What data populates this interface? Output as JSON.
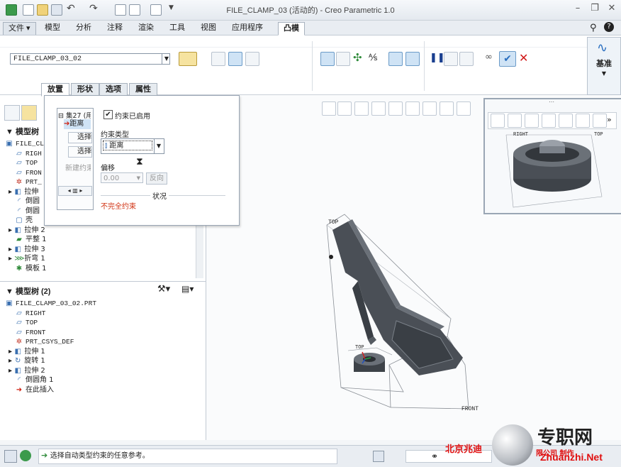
{
  "window": {
    "title": "FILE_CLAMP_03 (活动的) - Creo Parametric 1.0"
  },
  "menu": {
    "file": "文件",
    "tabs": [
      "模型",
      "分析",
      "注释",
      "渲染",
      "工具",
      "视图",
      "应用程序",
      "凸模"
    ],
    "active_tab": "凸模"
  },
  "ribbon": {
    "reference_model": "FILE_CLAMP_03_02",
    "datum_label": "基准"
  },
  "dashboard_tabs": [
    "放置",
    "形状",
    "选项",
    "属性"
  ],
  "placement": {
    "set_label": "集27 (用",
    "constraint_item": "距离",
    "select_a": "选择",
    "select_b": "选择",
    "new_constraint": "新建约束",
    "enabled_label": "约束已启用",
    "type_label": "约束类型",
    "type_value": "距离",
    "offset_label": "偏移",
    "offset_value": "0.00",
    "flip_button": "反向",
    "status_label": "状况",
    "status_value": "不完全约束"
  },
  "model_tree_1": {
    "title": "模型树",
    "items": [
      {
        "icon": "part",
        "label": "FILE_CL",
        "mono": true
      },
      {
        "icon": "plane",
        "label": "RIGH",
        "mono": true
      },
      {
        "icon": "plane",
        "label": "TOP",
        "mono": true
      },
      {
        "icon": "plane",
        "label": "FRON",
        "mono": true
      },
      {
        "icon": "csys",
        "label": "PRT_",
        "mono": true
      },
      {
        "icon": "extrude",
        "label": "拉伸",
        "expand": true
      },
      {
        "icon": "round",
        "label": "倒圆"
      },
      {
        "icon": "round",
        "label": "倒圆"
      },
      {
        "icon": "shell",
        "label": "壳 "
      },
      {
        "icon": "extrude",
        "label": "拉伸 2",
        "expand": true
      },
      {
        "icon": "flat",
        "label": "平整 1"
      },
      {
        "icon": "extrude",
        "label": "拉伸 3",
        "expand": true
      },
      {
        "icon": "bend",
        "label": "折弯 1",
        "expand": true
      },
      {
        "icon": "form",
        "label": "模板 1"
      }
    ]
  },
  "model_tree_2": {
    "title": "模型树 (2)",
    "items": [
      {
        "icon": "part",
        "label": "FILE_CLAMP_03_02.PRT",
        "mono": true
      },
      {
        "icon": "plane",
        "label": "RIGHT",
        "mono": true
      },
      {
        "icon": "plane",
        "label": "TOP",
        "mono": true
      },
      {
        "icon": "plane",
        "label": "FRONT",
        "mono": true
      },
      {
        "icon": "csys",
        "label": "PRT_CSYS_DEF",
        "mono": true
      },
      {
        "icon": "extrude",
        "label": "拉伸 1",
        "expand": true
      },
      {
        "icon": "revolve",
        "label": "旋转 1",
        "expand": true
      },
      {
        "icon": "extrude",
        "label": "拉伸 2",
        "expand": true
      },
      {
        "icon": "round",
        "label": "倒圆角 1"
      },
      {
        "icon": "insert-arrow",
        "label": "在此插入"
      }
    ]
  },
  "graphics": {
    "label_top": "TOP",
    "label_front": "FRONT",
    "label_top_small": "TOP",
    "mini_label_right": "RIGHT",
    "mini_label_top": "TOP"
  },
  "status": {
    "message": "选择自动类型约束的任意参考。"
  },
  "watermark": {
    "text_left": "北京兆迪",
    "text_right": "专职网",
    "text_mid": "限公司 制作",
    "url": "Zhuanzhi.Net"
  },
  "colors": {
    "accent": "#3a6fb0",
    "status_red": "#d03010",
    "model_dark": "#4a4f56",
    "watermark_red": "#e01010"
  }
}
